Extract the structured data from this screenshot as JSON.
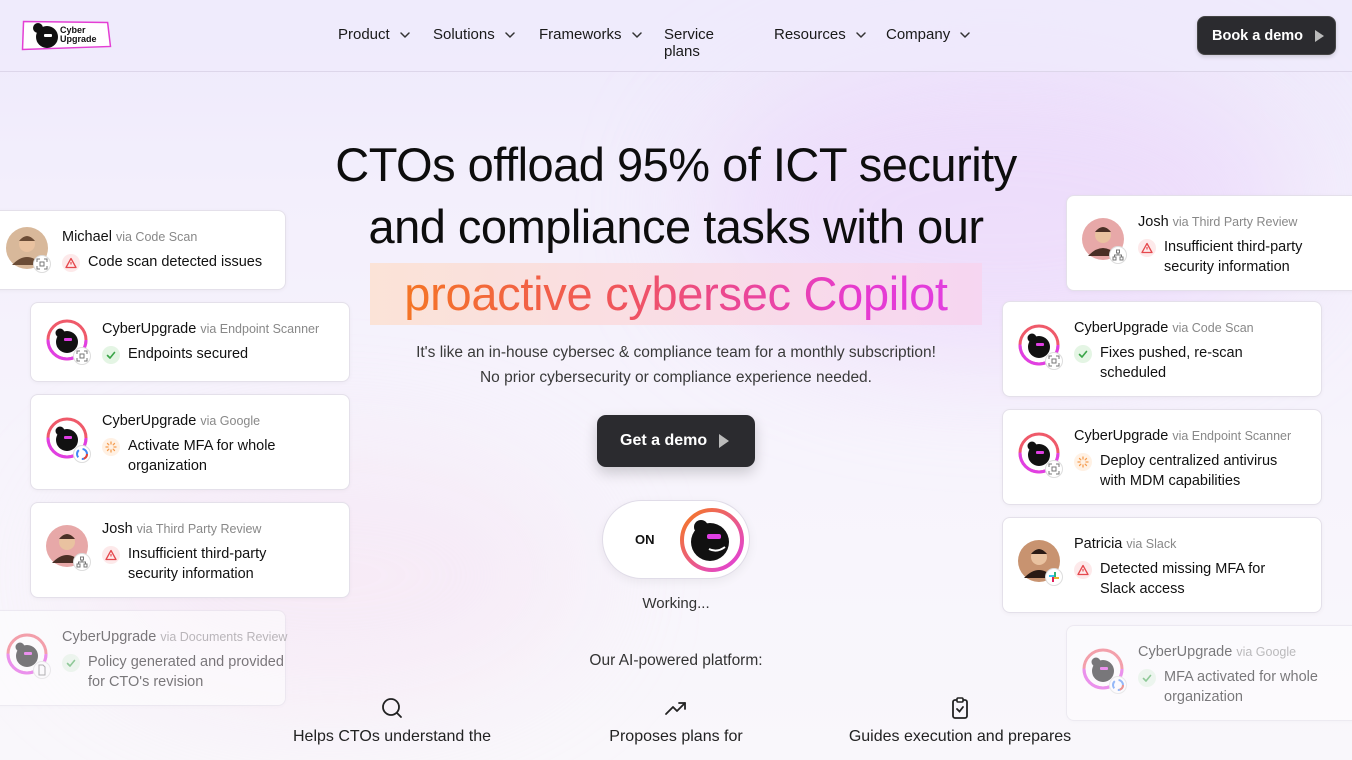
{
  "brand": {
    "logo_text_line1": "Cyber",
    "logo_text_line2": "Upgrade"
  },
  "nav": {
    "items": [
      {
        "label": "Product",
        "dropdown": true
      },
      {
        "label": "Solutions",
        "dropdown": true
      },
      {
        "label": "Frameworks",
        "dropdown": true
      },
      {
        "label": "Service plans",
        "dropdown": false
      },
      {
        "label": "Resources",
        "dropdown": true
      },
      {
        "label": "Company",
        "dropdown": true
      }
    ],
    "demo_button": "Book a demo"
  },
  "hero": {
    "title_line1": "CTOs offload 95% of ICT security",
    "title_line2": "and compliance tasks with our",
    "highlight": "proactive cybersec Copilot",
    "subtitle_line1": "It's like an in-house cybersec & compliance team for a monthly subscription!",
    "subtitle_line2": "No prior cybersecurity or compliance experience needed.",
    "cta": "Get a demo",
    "toggle_label": "ON",
    "status": "Working...",
    "platform_label": "Our AI-powered platform:"
  },
  "features": [
    {
      "icon": "search-icon",
      "text": "Helps CTOs understand the"
    },
    {
      "icon": "trending-up-icon",
      "text": "Proposes plans for"
    },
    {
      "icon": "clipboard-check-icon",
      "text": "Guides execution and prepares"
    }
  ],
  "cards": [
    {
      "id": "c1",
      "name": "Michael",
      "via": "via Code Scan",
      "status": "warn",
      "message": [
        "Code scan detected issues"
      ]
    },
    {
      "id": "c2",
      "name": "CyberUpgrade",
      "via": "via Endpoint Scanner",
      "status": "ok",
      "message": [
        "Endpoints secured"
      ]
    },
    {
      "id": "c3",
      "name": "CyberUpgrade",
      "via": "via Google",
      "status": "progress",
      "message": [
        "Activate MFA for whole",
        "organization"
      ]
    },
    {
      "id": "c4",
      "name": "Josh",
      "via": "via Third Party Review",
      "status": "warn",
      "message": [
        "Insufficient third-party",
        "security information"
      ]
    },
    {
      "id": "c5",
      "name": "CyberUpgrade",
      "via": "via Documents Review",
      "status": "ok",
      "message": [
        "Policy generated and provided",
        "for CTO's revision"
      ]
    },
    {
      "id": "c6",
      "name": "Josh",
      "via": "via Third Party Review",
      "status": "warn",
      "message": [
        "Insufficient third-party",
        "security information"
      ]
    },
    {
      "id": "c7",
      "name": "CyberUpgrade",
      "via": "via Code Scan",
      "status": "ok",
      "message": [
        "Fixes pushed, re-scan",
        "scheduled"
      ]
    },
    {
      "id": "c8",
      "name": "CyberUpgrade",
      "via": "via Endpoint Scanner",
      "status": "progress",
      "message": [
        "Deploy centralized antivirus",
        "with MDM capabilities"
      ]
    },
    {
      "id": "c9",
      "name": "Patricia",
      "via": "via Slack",
      "status": "warn",
      "message": [
        "Detected missing MFA for",
        "Slack access"
      ]
    },
    {
      "id": "c10",
      "name": "CyberUpgrade",
      "via": "via Google",
      "status": "ok",
      "message": [
        "MFA activated for whole",
        "organization"
      ]
    }
  ],
  "colors": {
    "accent_orange": "#f57a1c",
    "accent_magenta": "#e03fe4",
    "dark_button": "#2b2b2f"
  }
}
